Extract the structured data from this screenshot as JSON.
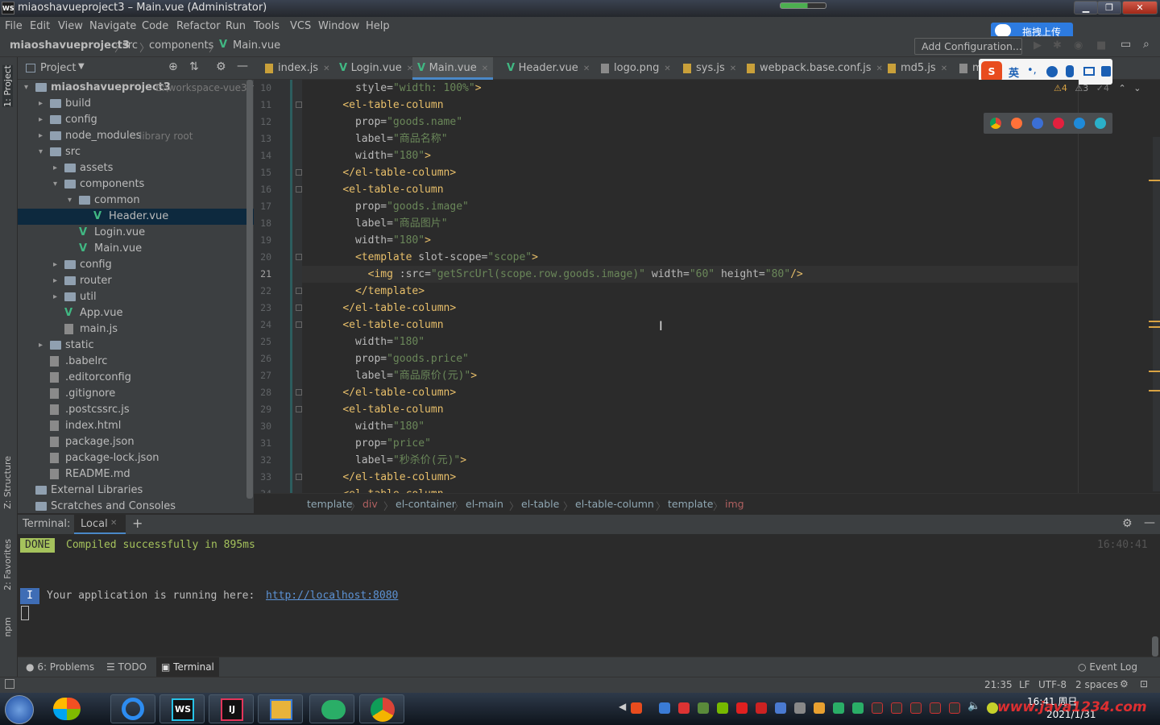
{
  "window": {
    "title": "miaoshavueproject3 – Main.vue (Administrator)",
    "logo": "WS"
  },
  "menu": [
    "File",
    "Edit",
    "View",
    "Navigate",
    "Code",
    "Refactor",
    "Run",
    "Tools",
    "VCS",
    "Window",
    "Help"
  ],
  "navbar": {
    "crumbs": [
      "miaoshavueproject3",
      "src",
      "components",
      "Main.vue"
    ],
    "run_config": "Add Configuration...",
    "upload": "拖拽上传"
  },
  "project_panel": {
    "title": "Project",
    "tree": [
      {
        "label": "miaoshavueproject3",
        "hint": "E:\\workspace-vue3\\r",
        "kind": "folder",
        "depth": 0,
        "arrow": "▾",
        "bold": true
      },
      {
        "label": "build",
        "kind": "folder",
        "depth": 1,
        "arrow": "▸"
      },
      {
        "label": "config",
        "kind": "folder",
        "depth": 1,
        "arrow": "▸"
      },
      {
        "label": "node_modules",
        "hint": "library root",
        "kind": "folder",
        "depth": 1,
        "arrow": "▸"
      },
      {
        "label": "src",
        "kind": "folder",
        "depth": 1,
        "arrow": "▾"
      },
      {
        "label": "assets",
        "kind": "folder",
        "depth": 2,
        "arrow": "▸"
      },
      {
        "label": "components",
        "kind": "folder",
        "depth": 2,
        "arrow": "▾"
      },
      {
        "label": "common",
        "kind": "folder",
        "depth": 3,
        "arrow": "▾"
      },
      {
        "label": "Header.vue",
        "kind": "vue",
        "depth": 4,
        "selected": true
      },
      {
        "label": "Login.vue",
        "kind": "vue",
        "depth": 3
      },
      {
        "label": "Main.vue",
        "kind": "vue",
        "depth": 3
      },
      {
        "label": "config",
        "kind": "folder",
        "depth": 2,
        "arrow": "▸"
      },
      {
        "label": "router",
        "kind": "folder",
        "depth": 2,
        "arrow": "▸"
      },
      {
        "label": "util",
        "kind": "folder",
        "depth": 2,
        "arrow": "▸"
      },
      {
        "label": "App.vue",
        "kind": "vue",
        "depth": 2
      },
      {
        "label": "main.js",
        "kind": "file",
        "depth": 2
      },
      {
        "label": "static",
        "kind": "folder",
        "depth": 1,
        "arrow": "▸"
      },
      {
        "label": ".babelrc",
        "kind": "file",
        "depth": 1
      },
      {
        "label": ".editorconfig",
        "kind": "file",
        "depth": 1
      },
      {
        "label": ".gitignore",
        "kind": "file",
        "depth": 1
      },
      {
        "label": ".postcssrc.js",
        "kind": "file",
        "depth": 1
      },
      {
        "label": "index.html",
        "kind": "file",
        "depth": 1
      },
      {
        "label": "package.json",
        "kind": "file",
        "depth": 1
      },
      {
        "label": "package-lock.json",
        "kind": "file",
        "depth": 1
      },
      {
        "label": "README.md",
        "kind": "file",
        "depth": 1
      },
      {
        "label": "External Libraries",
        "kind": "lib",
        "depth": 0
      },
      {
        "label": "Scratches and Consoles",
        "kind": "lib",
        "depth": 0
      }
    ]
  },
  "left_strip": [
    "1: Project",
    "Z: Structure",
    "2: Favorites",
    "npm"
  ],
  "tabs": [
    {
      "label": "index.js"
    },
    {
      "label": "Login.vue"
    },
    {
      "label": "Main.vue",
      "active": true
    },
    {
      "label": "Header.vue"
    },
    {
      "label": "logo.png"
    },
    {
      "label": "sys.js"
    },
    {
      "label": "webpack.base.conf.js"
    },
    {
      "label": "md5.js"
    },
    {
      "label": "m"
    }
  ],
  "inspections": {
    "warn1": "4",
    "warn2": "3",
    "warn3": "4"
  },
  "editor": {
    "first_line": 10,
    "current_line": 21,
    "lines": [
      [
        [
          "      ",
          "pu"
        ],
        [
          "style=",
          "attr"
        ],
        [
          "\"width: 100%\"",
          "str"
        ],
        [
          ">",
          "tag"
        ]
      ],
      [
        [
          "    ",
          "pu"
        ],
        [
          "<el-table-column",
          "tag"
        ]
      ],
      [
        [
          "      ",
          "pu"
        ],
        [
          "prop=",
          "attr"
        ],
        [
          "\"goods.name\"",
          "str"
        ]
      ],
      [
        [
          "      ",
          "pu"
        ],
        [
          "label=",
          "attr"
        ],
        [
          "\"商品名称\"",
          "str"
        ]
      ],
      [
        [
          "      ",
          "pu"
        ],
        [
          "width=",
          "attr"
        ],
        [
          "\"180\"",
          "str"
        ],
        [
          ">",
          "tag"
        ]
      ],
      [
        [
          "    ",
          "pu"
        ],
        [
          "</el-table-column>",
          "tag"
        ]
      ],
      [
        [
          "    ",
          "pu"
        ],
        [
          "<el-table-column",
          "tag"
        ]
      ],
      [
        [
          "      ",
          "pu"
        ],
        [
          "prop=",
          "attr"
        ],
        [
          "\"goods.image\"",
          "str"
        ]
      ],
      [
        [
          "      ",
          "pu"
        ],
        [
          "label=",
          "attr"
        ],
        [
          "\"商品图片\"",
          "str"
        ]
      ],
      [
        [
          "      ",
          "pu"
        ],
        [
          "width=",
          "attr"
        ],
        [
          "\"180\"",
          "str"
        ],
        [
          ">",
          "tag"
        ]
      ],
      [
        [
          "      ",
          "pu"
        ],
        [
          "<template ",
          "tag"
        ],
        [
          "slot-scope=",
          "attr"
        ],
        [
          "\"scope\"",
          "str"
        ],
        [
          ">",
          "tag"
        ]
      ],
      [
        [
          "        ",
          "pu"
        ],
        [
          "<img ",
          "tag"
        ],
        [
          ":src=",
          "attr"
        ],
        [
          "\"getSrcUrl(scope.row.goods.image)\"",
          "str"
        ],
        [
          " width=",
          "attr"
        ],
        [
          "\"60\"",
          "str"
        ],
        [
          " height=",
          "attr"
        ],
        [
          "\"80\"",
          "str"
        ],
        [
          "/>",
          "tag"
        ]
      ],
      [
        [
          "      ",
          "pu"
        ],
        [
          "</template>",
          "tag"
        ]
      ],
      [
        [
          "    ",
          "pu"
        ],
        [
          "</el-table-column>",
          "tag"
        ]
      ],
      [
        [
          "    ",
          "pu"
        ],
        [
          "<el-table-column",
          "tag"
        ]
      ],
      [
        [
          "      ",
          "pu"
        ],
        [
          "width=",
          "attr"
        ],
        [
          "\"180\"",
          "str"
        ]
      ],
      [
        [
          "      ",
          "pu"
        ],
        [
          "prop=",
          "attr"
        ],
        [
          "\"goods.price\"",
          "str"
        ]
      ],
      [
        [
          "      ",
          "pu"
        ],
        [
          "label=",
          "attr"
        ],
        [
          "\"商品原价(元)\"",
          "str"
        ],
        [
          ">",
          "tag"
        ]
      ],
      [
        [
          "    ",
          "pu"
        ],
        [
          "</el-table-column>",
          "tag"
        ]
      ],
      [
        [
          "    ",
          "pu"
        ],
        [
          "<el-table-column",
          "tag"
        ]
      ],
      [
        [
          "      ",
          "pu"
        ],
        [
          "width=",
          "attr"
        ],
        [
          "\"180\"",
          "str"
        ]
      ],
      [
        [
          "      ",
          "pu"
        ],
        [
          "prop=",
          "attr"
        ],
        [
          "\"price\"",
          "str"
        ]
      ],
      [
        [
          "      ",
          "pu"
        ],
        [
          "label=",
          "attr"
        ],
        [
          "\"秒杀价(元)\"",
          "str"
        ],
        [
          ">",
          "tag"
        ]
      ],
      [
        [
          "    ",
          "pu"
        ],
        [
          "</el-table-column>",
          "tag"
        ]
      ],
      [
        [
          "    ",
          "pu"
        ],
        [
          "<el-table-column",
          "tag"
        ]
      ]
    ]
  },
  "breadcrumb": [
    "template",
    "div",
    "el-container",
    "el-main",
    "el-table",
    "el-table-column",
    "template",
    "img"
  ],
  "terminal": {
    "label": "Terminal:",
    "tab": "Local",
    "done_badge": "DONE",
    "done_text": "Compiled successfully in 895ms",
    "time": "16:40:41",
    "info_badge": "I",
    "info_text": "Your application is running here: ",
    "url": "http://localhost:8080"
  },
  "bottom_tabs": [
    "6: Problems",
    "TODO",
    "Terminal"
  ],
  "event_log": "Event Log",
  "status": {
    "pos": "21:35",
    "lf": "LF",
    "enc": "UTF-8",
    "indent": "2 spaces"
  },
  "clock": {
    "time": "16:41 周日",
    "date": "2021/1/31"
  },
  "watermark": "www.java1234.com"
}
